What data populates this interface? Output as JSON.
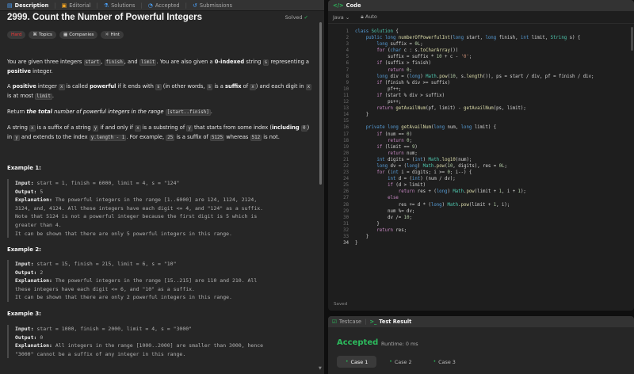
{
  "left_tabs": [
    {
      "icon": "description-icon",
      "glyph": "▤",
      "label": "Description",
      "active": true
    },
    {
      "icon": "editorial-icon",
      "glyph": "▣",
      "label": "Editorial"
    },
    {
      "icon": "solutions-icon",
      "glyph": "⚗",
      "label": "Solutions"
    },
    {
      "icon": "accepted-icon",
      "glyph": "◔",
      "label": "Accepted"
    },
    {
      "icon": "submissions-icon",
      "glyph": "↺",
      "label": "Submissions"
    }
  ],
  "problem": {
    "title": "2999. Count the Number of Powerful Integers",
    "solved_label": "Solved",
    "badges": {
      "difficulty": "Hard",
      "topics": "Topics",
      "companies": "Companies",
      "hint": "Hint"
    },
    "p1": {
      "t1": "You are given three integers ",
      "c1": "start",
      "t2": ", ",
      "c2": "finish",
      "t3": ", and ",
      "c3": "limit",
      "t4": ". You are also given a ",
      "b1": "0-indexed",
      "t5": " string ",
      "c4": "s",
      "t6": " representing a ",
      "b2": "positive",
      "t7": " integer."
    },
    "p2": {
      "t1": "A ",
      "b1": "positive",
      "t2": " integer ",
      "c1": "x",
      "t3": " is called ",
      "b2": "powerful",
      "t4": " if it ends with ",
      "c2": "s",
      "t5": " (in other words, ",
      "c3": "s",
      "t6": " is a ",
      "b3": "suffix",
      "t7": " of ",
      "c4": "x",
      "t8": ") and each digit in ",
      "c5": "x",
      "t9": " is at most ",
      "c6": "limit",
      "t10": "."
    },
    "p3": {
      "t1": "Return ",
      "b1": "the ",
      "bi1": "total",
      "b2": " number of powerful integers in the range ",
      "c1": "[start..finish]",
      "t2": "."
    },
    "p4": {
      "t1": "A string ",
      "c1": "x",
      "t2": " is a suffix of a string ",
      "c2": "y",
      "t3": " if and only if ",
      "c3": "x",
      "t4": " is a substring of ",
      "c4": "y",
      "t5": " that starts from some index (",
      "b1": "including ",
      "c5": "0",
      "t6": ") in ",
      "c6": "y",
      "t7": " and extends to the index ",
      "c7": "y.length - 1",
      "t8": ". For example, ",
      "c8": "25",
      "t9": " is a suffix of ",
      "c9": "5125",
      "t10": " whereas ",
      "c10": "512",
      "t11": " is not."
    },
    "examples": [
      {
        "heading": "Example 1:",
        "input": "start = 1, finish = 6000, limit = 4, s = \"124\"",
        "output": "5",
        "explanation": [
          "The powerful integers in the range [1..6000] are 124, 1124, 2124,",
          "3124, and, 4124. All these integers have each digit <= 4, and \"124\" as a suffix.",
          "Note that 5124 is not a powerful integer because the first digit is 5 which is",
          "greater than 4.",
          "It can be shown that there are only 5 powerful integers in this range."
        ]
      },
      {
        "heading": "Example 2:",
        "input": "start = 15, finish = 215, limit = 6, s = \"10\"",
        "output": "2",
        "explanation": [
          "The powerful integers in the range [15..215] are 110 and 210. All",
          "these integers have each digit <= 6, and \"10\" as a suffix.",
          "It can be shown that there are only 2 powerful integers in this range."
        ]
      },
      {
        "heading": "Example 3:",
        "input": "start = 1000, finish = 2000, limit = 4, s = \"3000\"",
        "output": "0",
        "explanation": [
          "All integers in the range [1000..2000] are smaller than 3000, hence",
          "\"3000\" cannot be a suffix of any integer in this range."
        ]
      }
    ],
    "labels": {
      "input": "Input:",
      "output": "Output:",
      "explanation": "Explanation:"
    }
  },
  "code_panel": {
    "tab_label": "Code",
    "language": "Java",
    "mode": "Auto",
    "saved": "Saved",
    "current_line": 34,
    "lines": [
      "class Solution {",
      "    public long numberOfPowerfulInt(long start, long finish, int limit, String s) {",
      "        long suffix = 0L;",
      "        for (char c : s.toCharArray())",
      "            suffix = suffix * 10 + c - '0';",
      "        if (suffix > finish)",
      "            return 0;",
      "        long div = (long) Math.pow(10, s.length()), ps = start / div, pf = finish / div;",
      "        if (finish % div >= suffix)",
      "            pf++;",
      "        if (start % div > suffix)",
      "            ps++;",
      "        return getAvailNum(pf, limit) - getAvailNum(ps, limit);",
      "    }",
      "",
      "    private long getAvailNum(long num, long limit) {",
      "        if (num == 0)",
      "            return 0;",
      "        if (limit == 9)",
      "            return num;",
      "        int digits = (int) Math.log10(num);",
      "        long dv = (long) Math.pow(10, digits), res = 0L;",
      "        for (int i = digits; i >= 0; i--) {",
      "            int d = (int) (num / dv);",
      "            if (d > limit)",
      "                return res + (long) Math.pow(limit + 1, i + 1);",
      "            else",
      "                res += d * (long) Math.pow(limit + 1, i);",
      "            num %= dv;",
      "            dv /= 10;",
      "        }",
      "        return res;",
      "    }",
      "}"
    ]
  },
  "result_panel": {
    "tabs": [
      {
        "label": "Testcase",
        "icon": "testcase-check-icon"
      },
      {
        "label": "Test Result",
        "icon": "terminal-icon"
      }
    ],
    "status": "Accepted",
    "runtime": "Runtime: 0 ms",
    "cases": [
      "Case 1",
      "Case 2",
      "Case 3"
    ]
  },
  "colors": {
    "accent_green": "#2cbb5d",
    "hard_red": "#f63737"
  }
}
